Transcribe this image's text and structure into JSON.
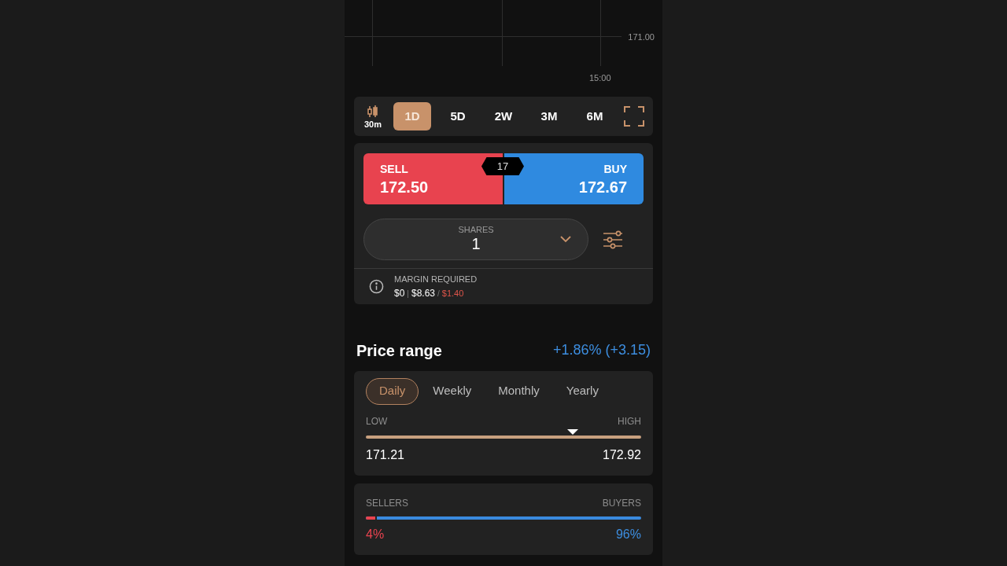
{
  "chart": {
    "price_label": "171.00",
    "time_label": "15:00"
  },
  "toolbar": {
    "interval": "30m",
    "periods": [
      {
        "label": "1D",
        "selected": true
      },
      {
        "label": "5D",
        "selected": false
      },
      {
        "label": "2W",
        "selected": false
      },
      {
        "label": "3M",
        "selected": false
      },
      {
        "label": "6M",
        "selected": false
      }
    ]
  },
  "trade": {
    "sell": {
      "label": "SELL",
      "price": "172.50"
    },
    "buy": {
      "label": "BUY",
      "price": "172.67"
    },
    "spread": "17",
    "shares": {
      "label": "SHARES",
      "value": "1"
    },
    "margin": {
      "label": "MARGIN REQUIRED",
      "parts": [
        {
          "text": "$0",
          "kind": "value"
        },
        {
          "text": "|",
          "kind": "separator"
        },
        {
          "text": "$8.63",
          "kind": "value"
        },
        {
          "text": "/",
          "kind": "separator"
        },
        {
          "text": "$1.40",
          "kind": "alert"
        }
      ]
    }
  },
  "price_range": {
    "title": "Price range",
    "change": "+1.86% (+3.15)",
    "tabs": [
      {
        "label": "Daily",
        "selected": true
      },
      {
        "label": "Weekly",
        "selected": false
      },
      {
        "label": "Monthly",
        "selected": false
      },
      {
        "label": "Yearly",
        "selected": false
      }
    ],
    "low_label": "LOW",
    "high_label": "HIGH",
    "level": 0.75,
    "low": "171.21",
    "high": "172.92"
  },
  "sentiment": {
    "sellers_label": "SELLERS",
    "buyers_label": "BUYERS",
    "level": 0.04,
    "sellers": "4%",
    "buyers": "96%"
  }
}
